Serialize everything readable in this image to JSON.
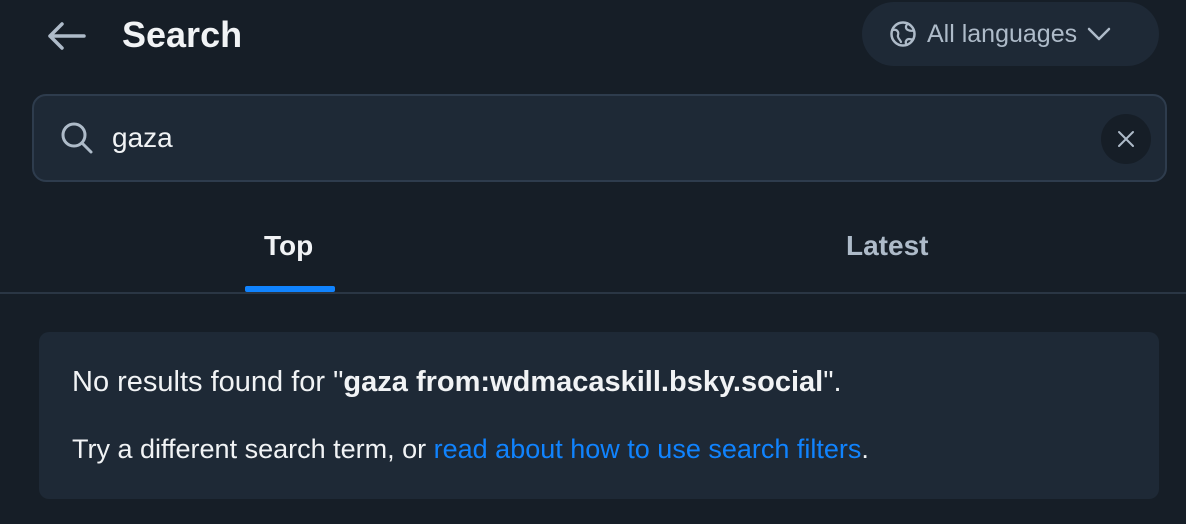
{
  "header": {
    "title": "Search",
    "back_icon": "arrow-left-icon",
    "language_button": {
      "label": "All languages",
      "icon": "globe-icon",
      "chevron": "chevron-down-icon"
    }
  },
  "search": {
    "value": "gaza",
    "icon": "magnifying-glass-icon",
    "clear_icon": "x-icon"
  },
  "tabs": [
    {
      "label": "Top",
      "active": true
    },
    {
      "label": "Latest",
      "active": false
    }
  ],
  "results": {
    "prefix": "No results found for \"",
    "query": "gaza from:wdmacaskill.bsky.social",
    "suffix": "\".",
    "hint_prefix": "Try a different search term, or ",
    "hint_link": "read about how to use search filters",
    "hint_suffix": "."
  },
  "colors": {
    "background": "#161e27",
    "surface": "#1e2936",
    "accent": "#1083fe",
    "muted_text": "#aebbc9"
  }
}
